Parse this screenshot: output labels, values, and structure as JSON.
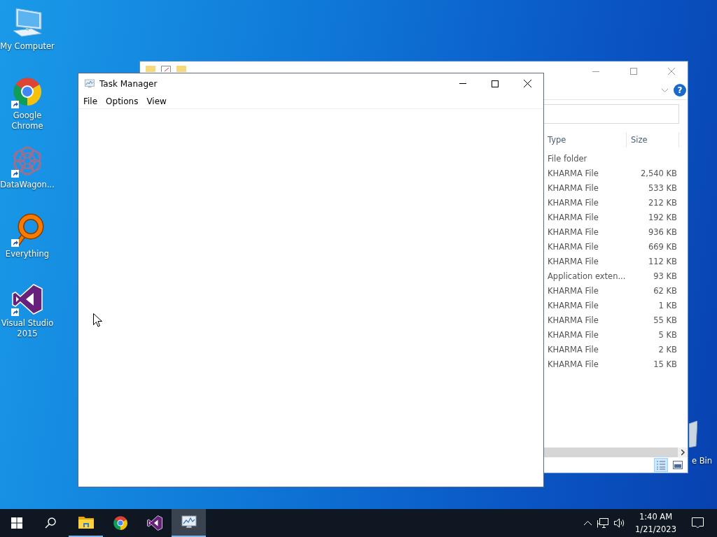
{
  "desktop_icons": [
    {
      "kind": "computer",
      "label": "My Computer",
      "shortcut": false
    },
    {
      "kind": "chrome",
      "label": "Google Chrome",
      "shortcut": true
    },
    {
      "kind": "datawagon",
      "label": "DataWagon...",
      "shortcut": true
    },
    {
      "kind": "everything",
      "label": "Everything",
      "shortcut": true
    },
    {
      "kind": "visualstudio",
      "label": "Visual Studio 2015",
      "shortcut": true
    }
  ],
  "recycle_bin": {
    "label": "e Bin"
  },
  "explorer": {
    "help": "?",
    "columns": [
      "Type",
      "Size"
    ],
    "rows": [
      {
        "type": "File folder",
        "size": ""
      },
      {
        "type": "KHARMA File",
        "size": "2,540 KB"
      },
      {
        "type": "KHARMA File",
        "size": "533 KB"
      },
      {
        "type": "KHARMA File",
        "size": "212 KB"
      },
      {
        "type": "KHARMA File",
        "size": "192 KB"
      },
      {
        "type": "KHARMA File",
        "size": "936 KB"
      },
      {
        "type": "KHARMA File",
        "size": "669 KB"
      },
      {
        "type": "KHARMA File",
        "size": "112 KB"
      },
      {
        "type": "Application exten...",
        "size": "93 KB"
      },
      {
        "type": "KHARMA File",
        "size": "62 KB"
      },
      {
        "type": "KHARMA File",
        "size": "1 KB"
      },
      {
        "type": "KHARMA File",
        "size": "55 KB"
      },
      {
        "type": "KHARMA File",
        "size": "5 KB"
      },
      {
        "type": "KHARMA File",
        "size": "2 KB"
      },
      {
        "type": "KHARMA File",
        "size": "15 KB"
      }
    ],
    "view_buttons": [
      {
        "kind": "details",
        "selected": true
      },
      {
        "kind": "preview",
        "selected": false
      }
    ]
  },
  "task_manager": {
    "title": "Task Manager",
    "menu": [
      "File",
      "Options",
      "View"
    ]
  },
  "taskbar": {
    "apps": [
      {
        "kind": "explorer",
        "running": true,
        "active": false
      },
      {
        "kind": "chrome",
        "running": false,
        "active": false
      },
      {
        "kind": "visualstudio",
        "running": false,
        "active": false
      },
      {
        "kind": "taskmanager",
        "running": true,
        "active": true
      }
    ],
    "time": "1:40 AM",
    "date": "1/21/2023"
  }
}
